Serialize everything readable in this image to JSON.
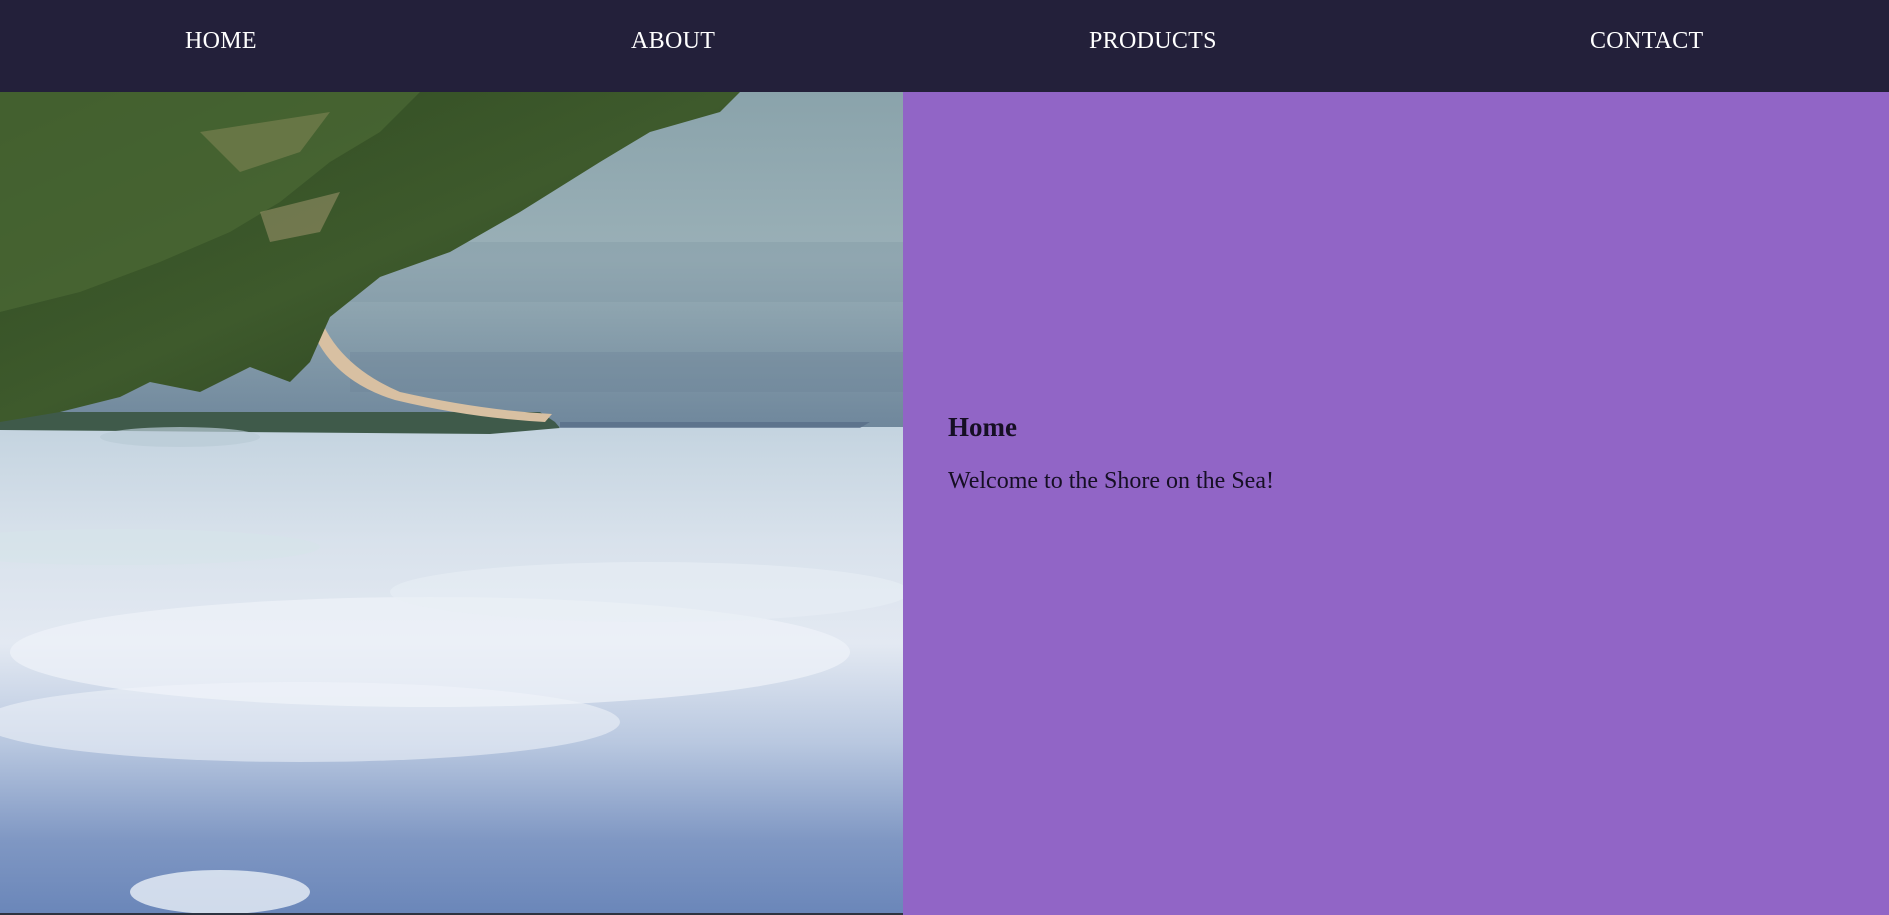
{
  "nav": {
    "items": [
      {
        "label": "HOME"
      },
      {
        "label": "ABOUT"
      },
      {
        "label": "PRODUCTS"
      },
      {
        "label": "CONTACT"
      }
    ]
  },
  "hero": {
    "image": "upside-down-shoreline-photo"
  },
  "content": {
    "heading": "Home",
    "text": "Welcome to the Shore on the Sea!"
  },
  "colors": {
    "navbar": "#23203a",
    "panel": "#9165c6",
    "text": "#160f24",
    "nav_text": "#ffffff"
  }
}
